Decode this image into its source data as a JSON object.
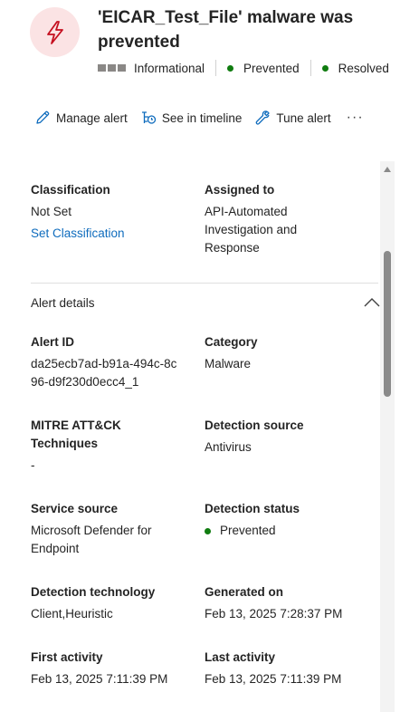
{
  "header": {
    "title": "'EICAR_Test_File' malware was prevented",
    "severity": "Informational",
    "detection_status": "Prevented",
    "alert_status": "Resolved",
    "icon": "alert-bolt-icon",
    "icon_color": "#c50f1f",
    "icon_bg": "#fbe3e4",
    "status_dot_color": "#107c10"
  },
  "toolbar": {
    "manage_label": "Manage alert",
    "timeline_label": "See in timeline",
    "tune_label": "Tune alert",
    "more_label": "···"
  },
  "details": {
    "classification_label": "Classification",
    "classification_value": "Not Set",
    "set_classification_link": "Set Classification",
    "assigned_label": "Assigned to",
    "assigned_value": "API-Automated Investigation and Response",
    "section_title": "Alert details",
    "alert_id_label": "Alert ID",
    "alert_id_value": "da25ecb7ad-b91a-494c-8c96-d9f230d0ecc4_1",
    "category_label": "Category",
    "category_value": "Malware",
    "mitre_label": "MITRE ATT&CK Techniques",
    "mitre_value": "-",
    "detection_source_label": "Detection source",
    "detection_source_value": "Antivirus",
    "service_source_label": "Service source",
    "service_source_value": "Microsoft Defender for Endpoint",
    "detection_status_label": "Detection status",
    "detection_status_value": "Prevented",
    "detection_tech_label": "Detection technology",
    "detection_tech_value": "Client,Heuristic",
    "generated_label": "Generated on",
    "generated_value": "Feb 13, 2025 7:28:37 PM",
    "first_activity_label": "First activity",
    "first_activity_value": "Feb 13, 2025 7:11:39 PM",
    "last_activity_label": "Last activity",
    "last_activity_value": "Feb 13, 2025 7:11:39 PM"
  }
}
